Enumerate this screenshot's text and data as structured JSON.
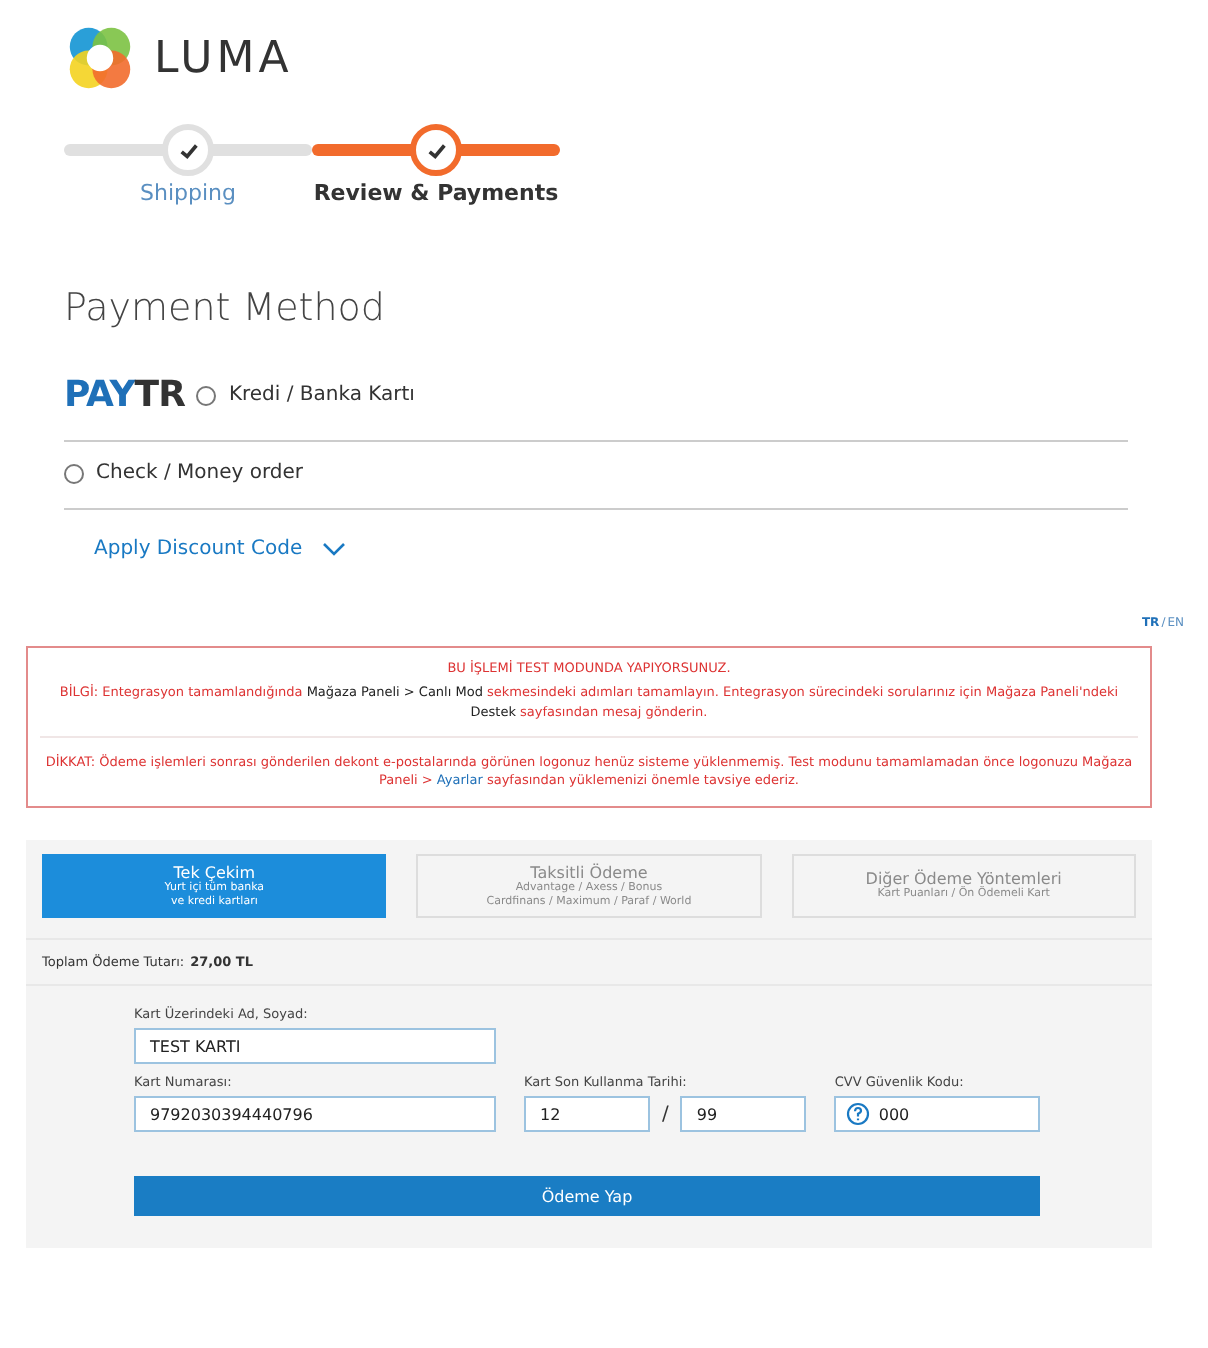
{
  "logo": {
    "text": "LUMA"
  },
  "progress": [
    {
      "label": "Shipping",
      "selected": false
    },
    {
      "label": "Review & Payments",
      "selected": true
    }
  ],
  "payment_method": {
    "title": "Payment Method",
    "paytr_logo": [
      "PAY",
      "TR"
    ],
    "options": [
      {
        "label": "Kredi / Banka Kartı",
        "checked": false,
        "kind": "paytr"
      },
      {
        "label": "Check / Money order",
        "checked": false,
        "kind": "plain"
      }
    ],
    "discount_link": "Apply Discount Code"
  },
  "language": {
    "active": "TR",
    "separator": "/",
    "other": "EN"
  },
  "notice": {
    "title": "BU İŞLEMİ TEST MODUNDA YAPIYORSUNUZ.",
    "paragraphs": [
      [
        {
          "text": "BİLGİ: Entegrasyon tamamlandığında ",
          "kind": "plain"
        },
        {
          "text": "Mağaza Paneli > Canlı Mod",
          "kind": "strong"
        },
        {
          "text": " sekmesindeki adımları tamamlayın. Entegrasyon sürecindeki sorularınız için Mağaza Paneli'ndeki ",
          "kind": "plain"
        },
        {
          "text": "Destek",
          "kind": "strong"
        },
        {
          "text": " sayfasından mesaj gönderin.",
          "kind": "plain"
        }
      ],
      [
        {
          "text": "DİKKAT: Ödeme işlemleri sonrası gönderilen dekont e-postalarında görünen logonuz henüz sisteme yüklenmemiş. Test modunu tamamlamadan önce logonuzu Mağaza Paneli > ",
          "kind": "plain"
        },
        {
          "text": "Ayarlar",
          "kind": "link"
        },
        {
          "text": " sayfasından yüklemenizi önemle tavsiye ederiz.",
          "kind": "plain"
        }
      ]
    ]
  },
  "tabs": [
    {
      "title": "Tek Çekim",
      "lines": [
        "Yurt içi tüm banka",
        "ve kredi kartları"
      ],
      "selected": true
    },
    {
      "title": "Taksitli Ödeme",
      "lines": [
        "Advantage / Axess / Bonus",
        "Cardfinans / Maximum / Paraf / World"
      ],
      "selected": false
    },
    {
      "title": "Diğer Ödeme Yöntemleri",
      "lines": [
        "Kart Puanları / Ön Ödemeli Kart"
      ],
      "selected": false
    }
  ],
  "total": {
    "label": "Toplam Ödeme Tutarı:",
    "amount": "27,00 TL"
  },
  "form": {
    "name_label": "Kart Üzerindeki Ad, Soyad:",
    "name_value": "TEST KARTI",
    "number_label": "Kart Numarası:",
    "number_value": "9792030394440796",
    "expiry_label": "Kart Son Kullanma Tarihi:",
    "month_value": "12",
    "separator": "/",
    "year_value": "99",
    "cvv_label": "CVV Güvenlik Kodu:",
    "cvv_value": "000",
    "submit": "Ödeme Yap"
  }
}
